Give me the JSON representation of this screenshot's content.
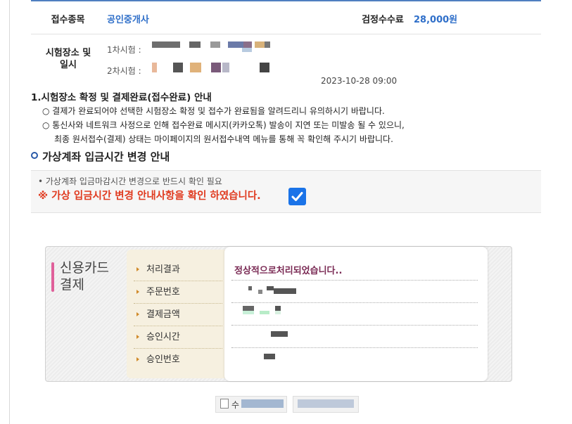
{
  "exam_info": {
    "type_label": "접수종목",
    "type_value": "공인중개사",
    "fee_label": "검정수수료",
    "fee_value": "28,000원",
    "venue_label": "시험장소 및 일시",
    "round1_label": "1차시험 :",
    "round1_datetime": "2023-10-28 09:00",
    "round2_label": "2차시험 :"
  },
  "notice1": {
    "title": "1.시험장소 확정 및 결제완료(접수완료) 안내",
    "line1": "○ 결제가 완료되어야 선택한 시험장소 확정 및 접수가 완료됨을 알려드리니 유의하시기 바랍니다.",
    "line2": "○ 통신사와 네트워크 사정으로 인해 접수완료 메시지(카카오톡) 발송이 지연 또는 미발송 될 수 있으니,",
    "line3": "최종 원서접수(결제) 상태는 마이페이지의 원서접수내역 메뉴를 통해 꼭 확인해 주시기 바랍니다."
  },
  "notice2": {
    "title": "가상계좌 입금시간 변경 안내",
    "line1": "• 가상계좌 입금마감시간 변경으로 반드시 확인 필요",
    "line2": "※ 가상 입금시간 변경 안내사항을 확인 하였습니다.",
    "checkbox_checked": true,
    "check_color": "#1a73e8",
    "warning_color": "#e03a1f"
  },
  "payment": {
    "title": "신용카드 결제",
    "labels": [
      "처리결과",
      "주문번호",
      "결제금액",
      "승인시간",
      "승인번호"
    ],
    "result": "정상적으로처리되었습니다..",
    "accent_color": "#e0609a"
  },
  "bottom_button": {
    "label": "수"
  }
}
